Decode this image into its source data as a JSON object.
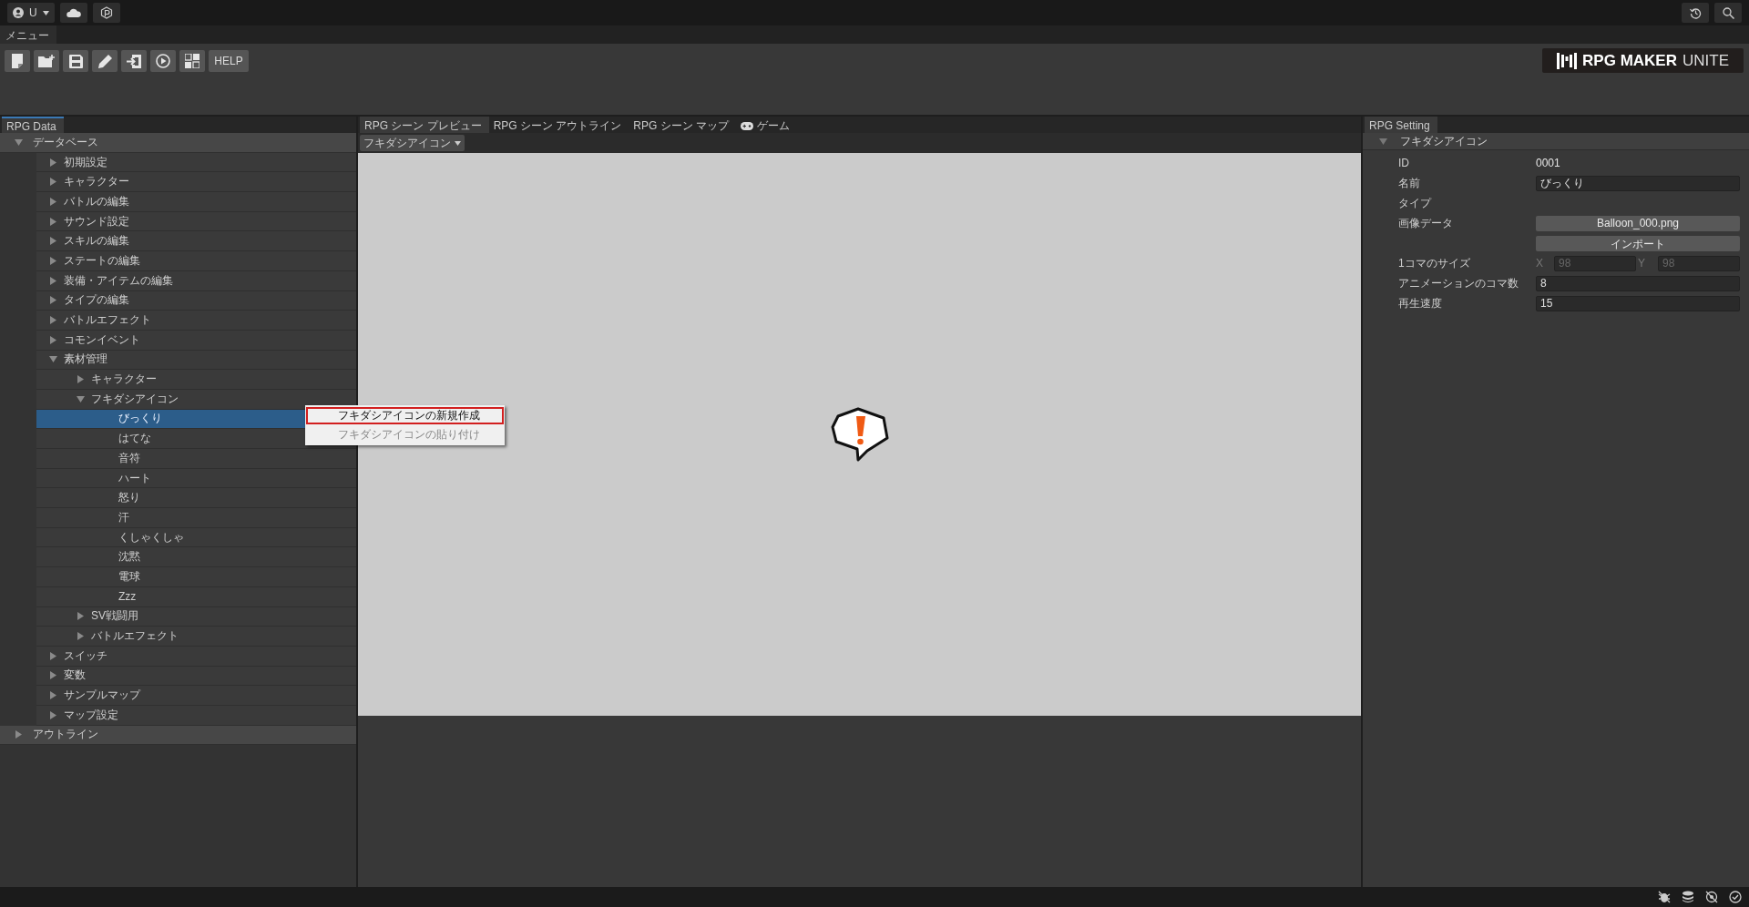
{
  "top_bar": {
    "account_label": "U"
  },
  "menu_tab": "メニュー",
  "toolbar": {
    "help_label": "HELP"
  },
  "logo": {
    "bold": "RPG MAKER",
    "light": "UNITE"
  },
  "left_panel": {
    "tab": "RPG Data",
    "tree": [
      {
        "label": "データベース",
        "expanded": true,
        "selected": false,
        "children": [
          {
            "label": "初期設定",
            "expanded": false,
            "selected": false
          },
          {
            "label": "キャラクター",
            "expanded": false,
            "selected": false
          },
          {
            "label": "バトルの編集",
            "expanded": false,
            "selected": false
          },
          {
            "label": "サウンド設定",
            "expanded": false,
            "selected": false
          },
          {
            "label": "スキルの編集",
            "expanded": false,
            "selected": false
          },
          {
            "label": "ステートの編集",
            "expanded": false,
            "selected": false
          },
          {
            "label": "装備・アイテムの編集",
            "expanded": false,
            "selected": false
          },
          {
            "label": "タイプの編集",
            "expanded": false,
            "selected": false
          },
          {
            "label": "バトルエフェクト",
            "expanded": false,
            "selected": false
          },
          {
            "label": "コモンイベント",
            "expanded": false,
            "selected": false
          },
          {
            "label": "素材管理",
            "expanded": true,
            "selected": false,
            "children": [
              {
                "label": "キャラクター",
                "expanded": false,
                "selected": false
              },
              {
                "label": "フキダシアイコン",
                "expanded": true,
                "selected": false,
                "children": [
                  {
                    "label": "びっくり",
                    "selected": true
                  },
                  {
                    "label": "はてな",
                    "selected": false
                  },
                  {
                    "label": "音符",
                    "selected": false
                  },
                  {
                    "label": "ハート",
                    "selected": false
                  },
                  {
                    "label": "怒り",
                    "selected": false
                  },
                  {
                    "label": "汗",
                    "selected": false
                  },
                  {
                    "label": "くしゃくしゃ",
                    "selected": false
                  },
                  {
                    "label": "沈黙",
                    "selected": false
                  },
                  {
                    "label": "電球",
                    "selected": false
                  },
                  {
                    "label": "Zzz",
                    "selected": false
                  }
                ]
              },
              {
                "label": "SV戦闘用",
                "expanded": false,
                "selected": false
              },
              {
                "label": "バトルエフェクト",
                "expanded": false,
                "selected": false
              }
            ]
          },
          {
            "label": "スイッチ",
            "expanded": false,
            "selected": false
          },
          {
            "label": "変数",
            "expanded": false,
            "selected": false
          },
          {
            "label": "サンプルマップ",
            "expanded": false,
            "selected": false
          },
          {
            "label": "マップ設定",
            "expanded": false,
            "selected": false
          }
        ]
      },
      {
        "label": "アウトライン",
        "expanded": false,
        "selected": false
      }
    ]
  },
  "context_menu": [
    {
      "label": "フキダシアイコンの新規作成",
      "focused": true,
      "disabled": false
    },
    {
      "label": "フキダシアイコンの貼り付け",
      "focused": false,
      "disabled": true
    }
  ],
  "center_panel": {
    "tabs": [
      {
        "label": "RPG シーン プレビュー",
        "kind": "plain",
        "selected": true
      },
      {
        "label": "RPG シーン アウトライン",
        "kind": "plain",
        "selected": false
      },
      {
        "label": "RPG シーン マップ",
        "kind": "plain",
        "selected": false
      },
      {
        "label": "ゲーム",
        "kind": "game",
        "selected": false
      }
    ],
    "dropdown": "フキダシアイコン"
  },
  "right_panel": {
    "tab": "RPG Setting",
    "section": {
      "title": "フキダシアイコン",
      "expanded": true
    },
    "rows": [
      {
        "kind": "readonly",
        "label": "ID",
        "value": "0001"
      },
      {
        "kind": "input",
        "label": "名前",
        "value": "びっくり"
      },
      {
        "kind": "label",
        "label": "タイプ"
      },
      {
        "kind": "button",
        "label": "画像データ",
        "value": "Balloon_000.png"
      },
      {
        "kind": "button",
        "value": "インポート"
      },
      {
        "kind": "xy",
        "label": "1コマのサイズ",
        "x_label": "X",
        "x_value": "98",
        "y_label": "Y",
        "y_value": "98",
        "disabled": true
      },
      {
        "kind": "input",
        "label": "アニメーションのコマ数",
        "value": "8"
      },
      {
        "kind": "input",
        "label": "再生速度",
        "value": "15"
      }
    ]
  }
}
